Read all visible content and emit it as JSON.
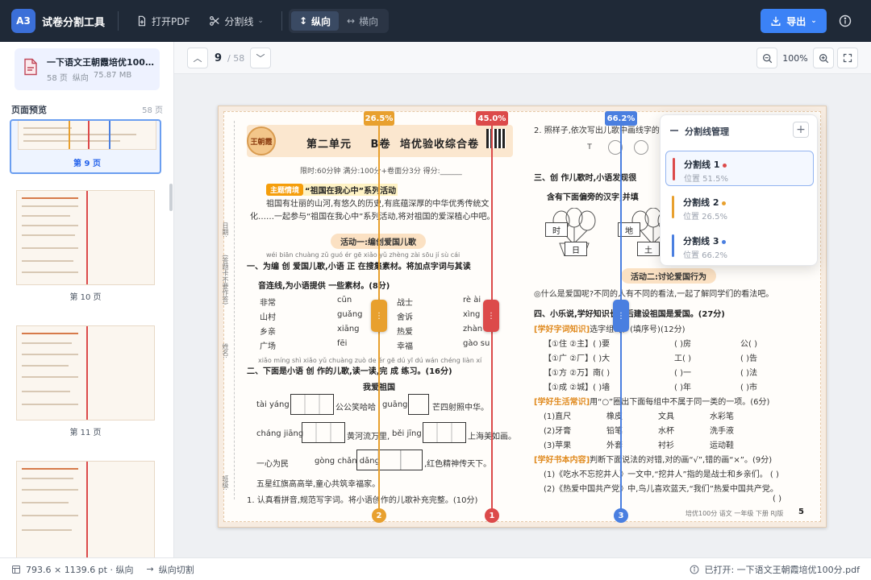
{
  "app": {
    "logo": "A3",
    "title": "试卷分割工具"
  },
  "toolbar": {
    "open_pdf": "打开PDF",
    "split_lines": "分割线",
    "vertical": "纵向",
    "horizontal": "横向",
    "export": "导出"
  },
  "file": {
    "name": "一下语文王朝霞培优100分.pdf",
    "pages": "58 页",
    "orientation": "纵向",
    "size": "75.87 MB"
  },
  "preview": {
    "title": "页面预览",
    "count": "58 页",
    "pages": [
      {
        "label": "第 9 页",
        "active": true
      },
      {
        "label": "第 10 页",
        "active": false
      },
      {
        "label": "第 11 页",
        "active": false
      },
      {
        "label": "",
        "active": false
      }
    ]
  },
  "nav": {
    "current_page": "9",
    "total": "/ 58"
  },
  "zoom": {
    "value": "100%"
  },
  "paper": {
    "badge": "王朝霞",
    "unit": "第二单元",
    "volume": "B卷",
    "title": "培优验收综合卷",
    "meta": "限时:60分钟   满分:100分+卷面分3分   得分:______",
    "theme_tag": "主题情境",
    "theme": "“祖国在我心中”系列活动",
    "intro1": "祖国有壮丽的山河,有悠久的历史,有底蕴深厚的中华优秀传统文",
    "intro2": "化……一起参与“祖国在我心中”系列活动,将对祖国的爱深植心中吧。",
    "activity1": "活动一:编创爱国儿歌",
    "q1_pinyin": "wéi biān chuàng  zǔ guó ér gē  xiǎo yǔ zhèng zài sōu jí sù cái",
    "q1": "一、为编 创 爱国儿歌,小语 正 在搜集素材。将加点字词与其读",
    "q1b": "音连线,为小语提供 一些素材。(8分)",
    "words_l": [
      "非常",
      "山村",
      "乡亲",
      "广场"
    ],
    "pinyin_m": [
      "cūn",
      "guǎng",
      "xiāng",
      "fēi"
    ],
    "words_r": [
      "战士",
      "舍诉",
      "热爱",
      "幸福"
    ],
    "pinyin_r": [
      "rè ài",
      "xìng",
      "zhàn",
      "gào su"
    ],
    "q2_pinyin": "xiǎo míng shì xiǎo yǔ chuàng zuò de ér gē dú yī dú wán chéng liàn xí",
    "q2": "二、下面是小语 创 作的儿歌,读一读,完 成 练习。(16分)",
    "poem_title": "我爱祖国",
    "line1a": "tài yáng",
    "line1b": "公公笑哈哈",
    "line1c": "guāng",
    "line1d": "芒四射照中华。",
    "line2a": "cháng jiāng",
    "line2b": "黄河流万里,",
    "line2c": "běi jīng",
    "line2d": "上海美如画。",
    "line3a": "一心为民",
    "line3b": "gòng chǎn dǎng",
    "line3c": ",红色精神传天下。",
    "line4": "五星红旗高高举,童心共筑幸福家。",
    "q2_1": "1. 认真看拼音,规范写字词。将小语创作的儿歌补充完整。(10分)",
    "r_q2": "2. 照样子,依次写出儿歌中画线字的",
    "r_q3": "三、创 作儿歌时,小语发现很",
    "r_q3b": "含有下面偏旁的汉字,并填",
    "flowers": [
      "时",
      "日",
      "地",
      "土"
    ],
    "activity2": "活动二:讨论爱国行为",
    "r_intro": "◎什么是爱国呢?不同的人有不同的看法,一起了解同学们的看法吧。",
    "r_q4": "四、小乐说,学好知识长大后建设祖国是爱国。(27分)",
    "r_q4_1_tag": "[学好字词知识]",
    "r_q4_1": "选字组词。(填序号)(12分)",
    "r_rows": [
      [
        "【①住 ②主】(  )要",
        "(  )房",
        "公(  )"
      ],
      [
        "【①广 ②厂】(  )大",
        "工(  )",
        "(  )告"
      ],
      [
        "【①方 ②万】南(  )",
        "(  )一",
        "(  )法"
      ],
      [
        "【①成 ②城】(  )墙",
        "(  )年",
        "(  )市"
      ]
    ],
    "r_q4_2_tag": "[学好生活常识]",
    "r_q4_2": "用“○”圈出下面每组中不属于同一类的一项。(6分)",
    "r_group": [
      [
        "(1)直尺",
        "橡皮",
        "文具",
        "水彩笔"
      ],
      [
        "(2)牙膏",
        "铅笔",
        "水杯",
        "洗手液"
      ],
      [
        "(3)苹果",
        "外套",
        "衬衫",
        "运动鞋"
      ]
    ],
    "r_q4_3_tag": "[学好书本内容]",
    "r_q4_3": "判断下面说法的对错,对的画“√”,错的画“×”。(9分)",
    "r_q4_3a": "(1)《吃水不忘挖井人》一文中,“挖井人”指的是战士和乡亲们。  (    )",
    "r_q4_3b": "(2)《热爱中国共产党》中,鸟儿喜欢蓝天,“我们”热爱中国共产党。",
    "r_paren": "(    )",
    "footer_left": "培优100分  语文  一年级  下册  RJ版",
    "footer_page": "5",
    "bind_labels": [
      "日期:",
      "姓名:",
      "班级:"
    ],
    "bind_note": "(答题卡不要作答)"
  },
  "split_lines": [
    {
      "id": "1",
      "name": "分割线 1",
      "color": "#dc4a4a",
      "percent": "45.0%",
      "position": "位置 51.5%"
    },
    {
      "id": "2",
      "name": "分割线 2",
      "color": "#e8a02e",
      "percent": "26.5%",
      "position": "位置 26.5%"
    },
    {
      "id": "3",
      "name": "分割线 3",
      "color": "#4a7fe0",
      "percent": "66.2%",
      "position": "位置 66.2%"
    }
  ],
  "panel": {
    "title": "分割线管理",
    "add": "+"
  },
  "status": {
    "dimensions": "793.6 × 1139.6 pt · 纵向",
    "mode": "纵向切割",
    "opened": "已打开: 一下语文王朝霞培优100分.pdf"
  }
}
